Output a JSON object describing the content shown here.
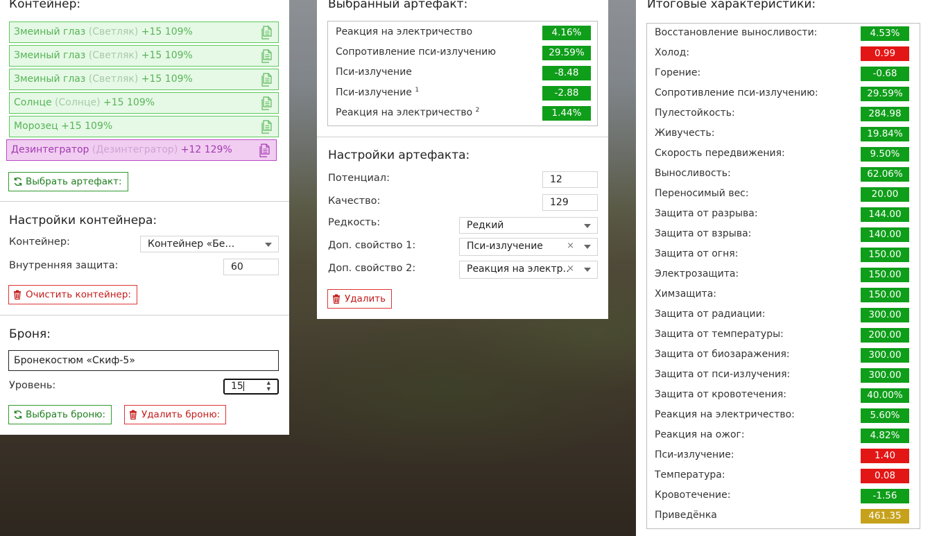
{
  "container": {
    "title": "Контейнер:",
    "items": [
      {
        "name": "Змеиный глаз",
        "sub": "(Светляк)",
        "level": "+15 109%",
        "selected": false
      },
      {
        "name": "Змеиный глаз",
        "sub": "(Светляк)",
        "level": "+15 109%",
        "selected": false
      },
      {
        "name": "Змеиный глаз",
        "sub": "(Светляк)",
        "level": "+15 109%",
        "selected": false
      },
      {
        "name": "Солнце",
        "sub": "(Солнце)",
        "level": "+15 109%",
        "selected": false
      },
      {
        "name": "Морозец",
        "sub": "",
        "level": "+15 109%",
        "selected": false
      },
      {
        "name": "Дезинтегратор",
        "sub": "(Дезинтегратор)",
        "level": "+12 129%",
        "selected": true
      }
    ],
    "choose_artifact_label": "Выбрать артефакт:"
  },
  "container_settings": {
    "title": "Настройки контейнера:",
    "container_label": "Контейнер:",
    "container_value": "Контейнер «Берлога…",
    "protection_label": "Внутренняя защита:",
    "protection_value": "60",
    "clear_label": "Очистить контейнер:"
  },
  "armor": {
    "title": "Броня:",
    "name_value": "Бронекостюм «Скиф-5»",
    "level_label": "Уровень:",
    "level_value": "15",
    "choose_label": "Выбрать броню:",
    "delete_label": "Удалить броню:"
  },
  "selected_artifact": {
    "title": "Выбранный артефакт:",
    "stats": [
      {
        "name": "Реакция на электричество",
        "sup": "",
        "value": "4.16%",
        "color": "green"
      },
      {
        "name": "Сопротивление пси-излучению",
        "sup": "",
        "value": "29.59%",
        "color": "green"
      },
      {
        "name": "Пси-излучение",
        "sup": "",
        "value": "-8.48",
        "color": "green"
      },
      {
        "name": "Пси-излучение",
        "sup": "1",
        "value": "-2.88",
        "color": "green"
      },
      {
        "name": "Реакция на электричество",
        "sup": "2",
        "value": "1.44%",
        "color": "green"
      }
    ]
  },
  "artifact_settings": {
    "title": "Настройки артефакта:",
    "potential_label": "Потенциал:",
    "potential_value": "12",
    "quality_label": "Качество:",
    "quality_value": "129",
    "rarity_label": "Редкость:",
    "rarity_value": "Редкий",
    "prop1_label": "Доп. свойство 1:",
    "prop1_value": "Пси-излучение",
    "prop2_label": "Доп. свойство 2:",
    "prop2_value": "Реакция на электр…",
    "delete_label": "Удалить"
  },
  "totals": {
    "title": "Итоговые характеристики:",
    "stats": [
      {
        "name": "Восстановление выносливости:",
        "value": "4.53%",
        "color": "green"
      },
      {
        "name": "Холод:",
        "value": "0.99",
        "color": "red"
      },
      {
        "name": "Горение:",
        "value": "-0.68",
        "color": "green"
      },
      {
        "name": "Сопротивление пси-излучению:",
        "value": "29.59%",
        "color": "green"
      },
      {
        "name": "Пулестойкость:",
        "value": "284.98",
        "color": "green"
      },
      {
        "name": "Живучесть:",
        "value": "19.84%",
        "color": "green"
      },
      {
        "name": "Скорость передвижения:",
        "value": "9.50%",
        "color": "green"
      },
      {
        "name": "Выносливость:",
        "value": "62.06%",
        "color": "green"
      },
      {
        "name": "Переносимый вес:",
        "value": "20.00",
        "color": "green"
      },
      {
        "name": "Защита от разрыва:",
        "value": "144.00",
        "color": "green"
      },
      {
        "name": "Защита от взрыва:",
        "value": "140.00",
        "color": "green"
      },
      {
        "name": "Защита от огня:",
        "value": "150.00",
        "color": "green"
      },
      {
        "name": "Электрозащита:",
        "value": "150.00",
        "color": "green"
      },
      {
        "name": "Химзащита:",
        "value": "150.00",
        "color": "green"
      },
      {
        "name": "Защита от радиации:",
        "value": "300.00",
        "color": "green"
      },
      {
        "name": "Защита от температуры:",
        "value": "200.00",
        "color": "green"
      },
      {
        "name": "Защита от биозаражения:",
        "value": "300.00",
        "color": "green"
      },
      {
        "name": "Защита от пси-излучения:",
        "value": "300.00",
        "color": "green"
      },
      {
        "name": "Защита от кровотечения:",
        "value": "40.00%",
        "color": "green"
      },
      {
        "name": "Реакция на электричество:",
        "value": "5.60%",
        "color": "green"
      },
      {
        "name": "Реакция на ожог:",
        "value": "4.82%",
        "color": "green"
      },
      {
        "name": "Пси-излучение:",
        "value": "1.40",
        "color": "red"
      },
      {
        "name": "Температура:",
        "value": "0.08",
        "color": "red"
      },
      {
        "name": "Кровотечение:",
        "value": "-1.56",
        "color": "green"
      },
      {
        "name": "Приведёнка",
        "value": "461.35",
        "color": "yellow"
      }
    ]
  },
  "colors": {
    "green": "#0f9e1a",
    "red": "#e31616",
    "yellow": "#c6a21c"
  },
  "icons": {
    "copy": "copy-icon",
    "refresh": "refresh-icon",
    "trash": "trash-icon"
  }
}
